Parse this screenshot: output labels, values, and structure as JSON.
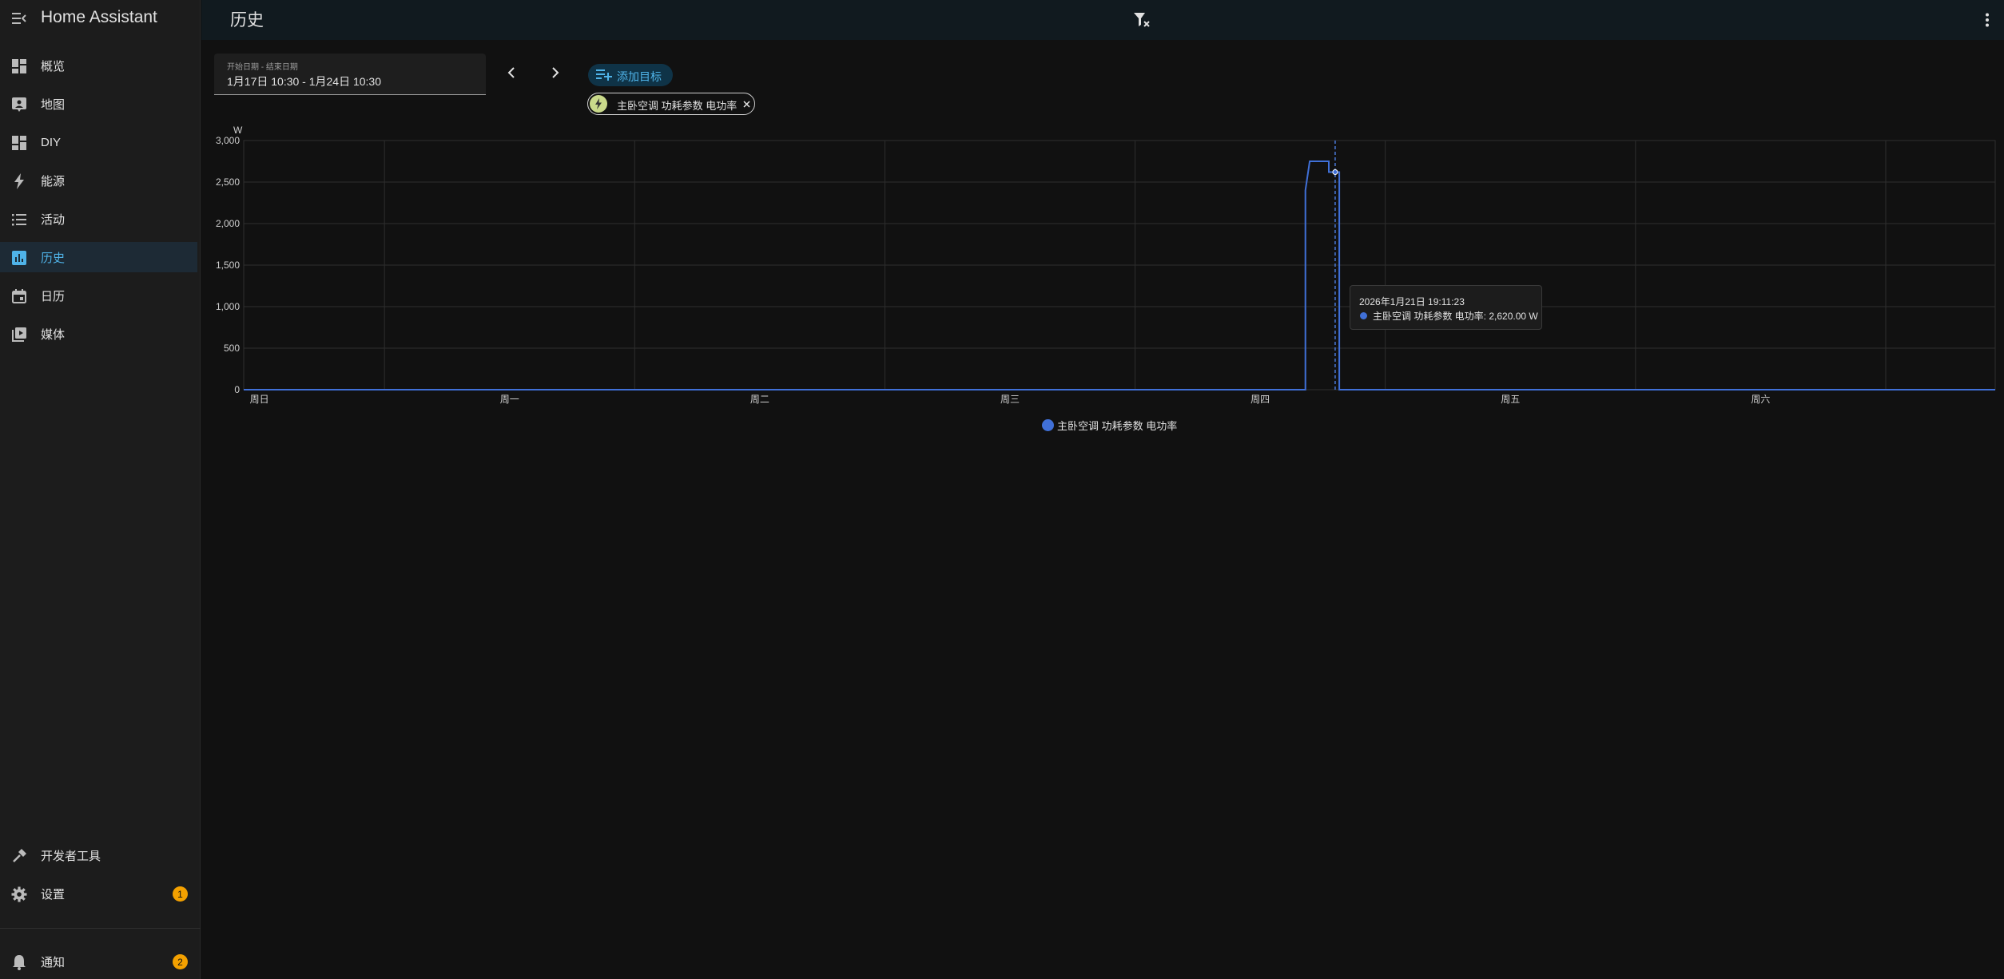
{
  "app": {
    "title": "Home Assistant"
  },
  "sidebar": {
    "items": [
      {
        "label": "概览",
        "icon": "dashboard-icon"
      },
      {
        "label": "地图",
        "icon": "map-icon"
      },
      {
        "label": "DIY",
        "icon": "dashboard-icon"
      },
      {
        "label": "能源",
        "icon": "lightning-icon"
      },
      {
        "label": "活动",
        "icon": "list-icon"
      },
      {
        "label": "历史",
        "icon": "chart-box-icon",
        "active": true
      },
      {
        "label": "日历",
        "icon": "calendar-icon"
      },
      {
        "label": "媒体",
        "icon": "media-icon"
      }
    ],
    "bottom_items": [
      {
        "label": "开发者工具",
        "icon": "hammer-icon"
      },
      {
        "label": "设置",
        "icon": "gear-icon",
        "badge": "1"
      }
    ],
    "notifications": {
      "label": "通知",
      "icon": "bell-icon",
      "badge": "2"
    }
  },
  "header": {
    "title": "历史"
  },
  "date_range": {
    "label": "开始日期 - 结束日期",
    "value": "1月17日 10:30 - 1月24日 10:30"
  },
  "add_target_label": "添加目标",
  "target_chip": {
    "label": "主卧空调 功耗参数 电功率",
    "icon": "lightning-icon"
  },
  "tooltip": {
    "timestamp": "2026年1月21日 19:11:23",
    "entry": "主卧空调 功耗参数 电功率: 2,620.00 W"
  },
  "colors": {
    "accent": "#4fb3e8",
    "series": "#4070d8",
    "badge": "#f4a100"
  },
  "chart_data": {
    "type": "line",
    "unit_label": "W",
    "ylim": [
      0,
      3000
    ],
    "y_ticks": [
      "0",
      "500",
      "1,000",
      "1,500",
      "2,000",
      "2,500",
      "3,000"
    ],
    "y_tick_values": [
      0,
      500,
      1000,
      1500,
      2000,
      2500,
      3000
    ],
    "x_tick_labels": [
      "周日",
      "周一",
      "周二",
      "周三",
      "周四",
      "周五",
      "周六"
    ],
    "x_range": [
      "2026-01-17 10:30",
      "2026-01-24 10:30"
    ],
    "grid": true,
    "legend_position": "bottom",
    "series": [
      {
        "name": "主卧空调 功耗参数 电功率",
        "points": [
          {
            "x": "2026-01-17 10:30",
            "y": 0
          },
          {
            "x": "2026-01-21 16:20",
            "y": 0
          },
          {
            "x": "2026-01-21 16:20",
            "y": 2400
          },
          {
            "x": "2026-01-21 16:45",
            "y": 2750
          },
          {
            "x": "2026-01-21 18:35",
            "y": 2750
          },
          {
            "x": "2026-01-21 18:35",
            "y": 2620
          },
          {
            "x": "2026-01-21 19:35",
            "y": 2620
          },
          {
            "x": "2026-01-21 19:35",
            "y": 0
          },
          {
            "x": "2026-01-24 10:30",
            "y": 0
          }
        ]
      }
    ],
    "hover": {
      "x": "2026-01-21 19:11:23",
      "y": 2620
    }
  }
}
